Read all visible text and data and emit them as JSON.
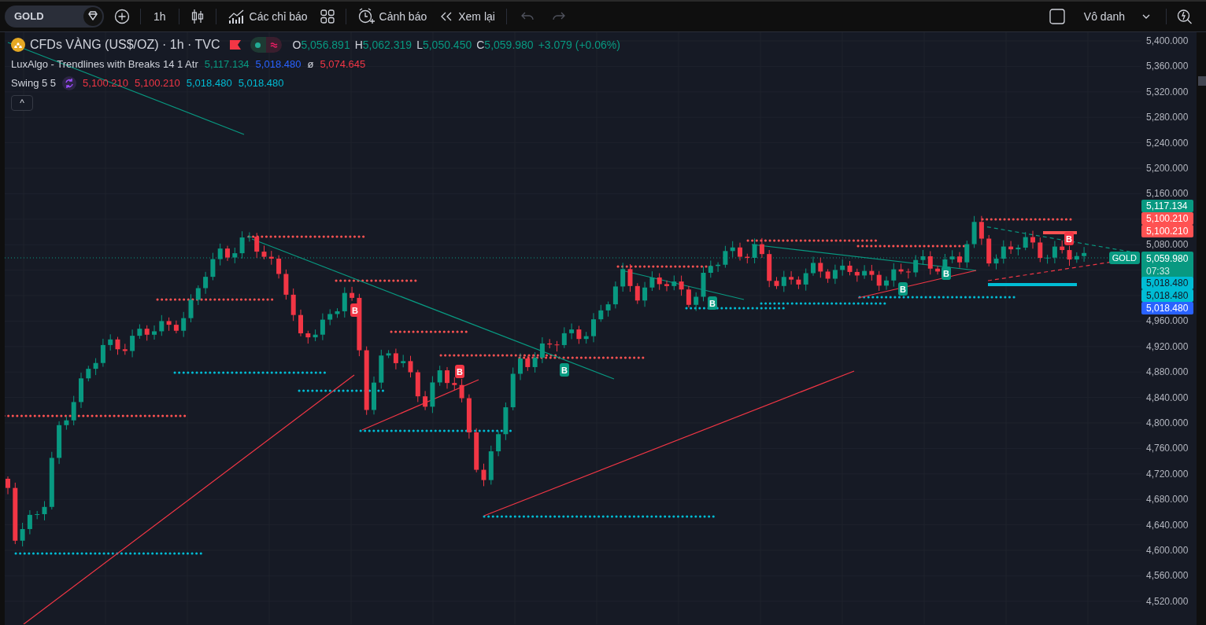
{
  "toolbar": {
    "symbol": "GOLD",
    "interval": "1h",
    "indicators": "Các chỉ báo",
    "alerts": "Cảnh báo",
    "replay": "Xem lại",
    "undo": {
      "disabled": true
    },
    "redo": {
      "disabled": true
    },
    "layout_name": "Vô danh"
  },
  "legend": {
    "title": "CFDs VÀNG (US$/OZ) · 1h · TVC",
    "ohlc": [
      {
        "key": "O",
        "value": "5,056.891"
      },
      {
        "key": "H",
        "value": "5,062.319"
      },
      {
        "key": "L",
        "value": "5,050.450"
      },
      {
        "key": "C",
        "value": "5,059.980"
      }
    ],
    "change": "+3.079 (+0.06%)",
    "indicators": [
      {
        "kind": "plain",
        "name": "LuxAlgo - Trendlines with Breaks 14 1 Atr",
        "values": [
          {
            "text": "5,117.134",
            "color": "#089981"
          },
          {
            "text": "5,018.480",
            "color": "#2962ff"
          },
          {
            "text": "ø",
            "color": "#d1d4dc"
          },
          {
            "text": "5,074.645",
            "color": "#f23645"
          }
        ]
      },
      {
        "kind": "with_icon",
        "name": "Swing 5 5",
        "values": [
          {
            "text": "5,100.210",
            "color": "#f23645"
          },
          {
            "text": "5,100.210",
            "color": "#f23645"
          },
          {
            "text": "5,018.480",
            "color": "#00bcd4"
          },
          {
            "text": "5,018.480",
            "color": "#00bcd4"
          }
        ]
      }
    ],
    "collapse": "^"
  },
  "markers": [
    {
      "label": "B",
      "kind": "down"
    },
    {
      "label": "B",
      "kind": "down"
    },
    {
      "label": "B",
      "kind": "up"
    },
    {
      "label": "B",
      "kind": "up"
    },
    {
      "label": "B",
      "kind": "up"
    },
    {
      "label": "B",
      "kind": "up"
    },
    {
      "label": "B",
      "kind": "down"
    }
  ],
  "price_line_label": "GOLD",
  "price_axis": [
    "5,400.000",
    "5,360.000",
    "5,320.000",
    "5,280.000",
    "5,240.000",
    "5,200.000",
    "5,160.000",
    "5,080.000",
    "4,960.000",
    "4,920.000",
    "4,880.000",
    "4,840.000",
    "4,800.000",
    "4,760.000",
    "4,720.000",
    "4,680.000",
    "4,640.000",
    "4,600.000",
    "4,560.000",
    "4,520.000"
  ],
  "price_tags": [
    {
      "text": "5,117.134",
      "color": "#089981"
    },
    {
      "text": "5,100.210",
      "color": "#ff5252"
    },
    {
      "text": "5,100.210",
      "color": "#ff5252"
    },
    {
      "text": "5,059.980",
      "time": "07:33",
      "color": "#089981"
    },
    {
      "text": "5,018.480",
      "color": "#00bcd4"
    },
    {
      "text": "5,018.480",
      "color": "#00bcd4"
    },
    {
      "text": "5,018.480",
      "color": "#2962ff"
    }
  ]
}
